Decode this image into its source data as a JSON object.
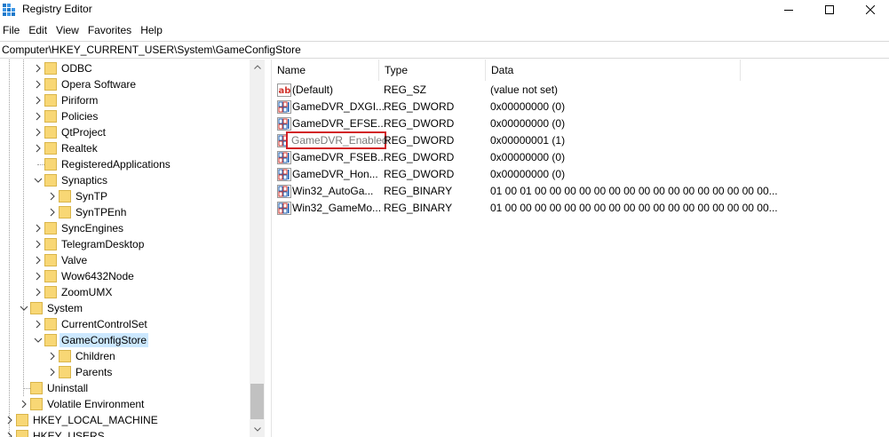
{
  "window": {
    "title": "Registry Editor",
    "icons": {
      "app": "registry-editor-icon",
      "minimize": "minimize-icon",
      "maximize": "maximize-icon",
      "close": "close-icon"
    }
  },
  "menu": [
    "File",
    "Edit",
    "View",
    "Favorites",
    "Help"
  ],
  "address": "Computer\\HKEY_CURRENT_USER\\System\\GameConfigStore",
  "tree": [
    {
      "label": "ODBC",
      "depth": 2,
      "expander": "collapsed"
    },
    {
      "label": "Opera Software",
      "depth": 2,
      "expander": "collapsed"
    },
    {
      "label": "Piriform",
      "depth": 2,
      "expander": "collapsed"
    },
    {
      "label": "Policies",
      "depth": 2,
      "expander": "collapsed"
    },
    {
      "label": "QtProject",
      "depth": 2,
      "expander": "collapsed"
    },
    {
      "label": "Realtek",
      "depth": 2,
      "expander": "collapsed"
    },
    {
      "label": "RegisteredApplications",
      "depth": 2,
      "expander": "none"
    },
    {
      "label": "Synaptics",
      "depth": 2,
      "expander": "expanded"
    },
    {
      "label": "SynTP",
      "depth": 3,
      "expander": "collapsed"
    },
    {
      "label": "SynTPEnh",
      "depth": 3,
      "expander": "collapsed"
    },
    {
      "label": "SyncEngines",
      "depth": 2,
      "expander": "collapsed"
    },
    {
      "label": "TelegramDesktop",
      "depth": 2,
      "expander": "collapsed"
    },
    {
      "label": "Valve",
      "depth": 2,
      "expander": "collapsed"
    },
    {
      "label": "Wow6432Node",
      "depth": 2,
      "expander": "collapsed"
    },
    {
      "label": "ZoomUMX",
      "depth": 2,
      "expander": "collapsed"
    },
    {
      "label": "System",
      "depth": 1,
      "expander": "expanded"
    },
    {
      "label": "CurrentControlSet",
      "depth": 2,
      "expander": "collapsed"
    },
    {
      "label": "GameConfigStore",
      "depth": 2,
      "expander": "expanded",
      "selected": true
    },
    {
      "label": "Children",
      "depth": 3,
      "expander": "collapsed"
    },
    {
      "label": "Parents",
      "depth": 3,
      "expander": "collapsed"
    },
    {
      "label": "Uninstall",
      "depth": 1,
      "expander": "none"
    },
    {
      "label": "Volatile Environment",
      "depth": 1,
      "expander": "collapsed"
    },
    {
      "label": "HKEY_LOCAL_MACHINE",
      "depth": 0,
      "expander": "collapsed"
    },
    {
      "label": "HKEY_USERS",
      "depth": 0,
      "expander": "collapsed"
    }
  ],
  "columns": {
    "name": "Name",
    "type": "Type",
    "data": "Data"
  },
  "values": [
    {
      "name": "(Default)",
      "type": "REG_SZ",
      "data": "(value not set)",
      "icon": "string-value-icon"
    },
    {
      "name": "GameDVR_DXGI...",
      "type": "REG_DWORD",
      "data": "0x00000000 (0)",
      "icon": "binary-value-icon"
    },
    {
      "name": "GameDVR_EFSE...",
      "type": "REG_DWORD",
      "data": "0x00000000 (0)",
      "icon": "binary-value-icon"
    },
    {
      "name": "GameDVR_Enabled",
      "type": "REG_DWORD",
      "data": "0x00000001 (1)",
      "icon": "binary-value-icon",
      "editing": true
    },
    {
      "name": "GameDVR_FSEB...",
      "type": "REG_DWORD",
      "data": "0x00000000 (0)",
      "icon": "binary-value-icon"
    },
    {
      "name": "GameDVR_Hon...",
      "type": "REG_DWORD",
      "data": "0x00000000 (0)",
      "icon": "binary-value-icon"
    },
    {
      "name": "Win32_AutoGa...",
      "type": "REG_BINARY",
      "data": "01 00 01 00 00 00 00 00 00 00 00 00 00 00 00 00 00 00 00...",
      "icon": "binary-value-icon"
    },
    {
      "name": "Win32_GameMo...",
      "type": "REG_BINARY",
      "data": "01 00 00 00 00 00 00 00 00 00 00 00 00 00 00 00 00 00 00...",
      "icon": "binary-value-icon"
    }
  ],
  "colors": {
    "selection": "#cce8ff",
    "highlight_border": "#d21f26",
    "folder": "#f8d775"
  }
}
